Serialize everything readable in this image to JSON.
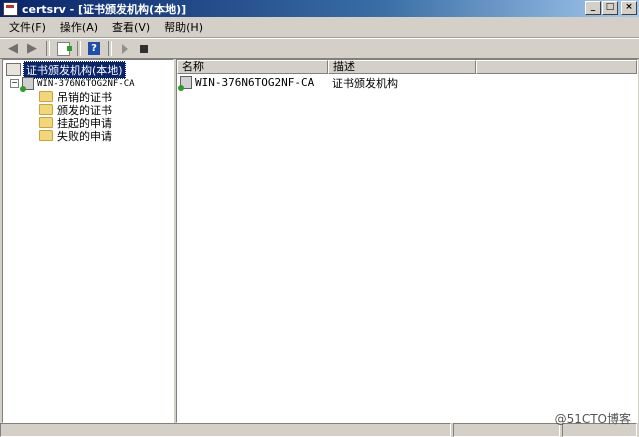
{
  "window": {
    "title": "certsrv - [证书颁发机构(本地)]",
    "buttons": [
      "_",
      "□",
      "×"
    ]
  },
  "menu": [
    {
      "label": "文件(F)"
    },
    {
      "label": "操作(A)"
    },
    {
      "label": "查看(V)"
    },
    {
      "label": "帮助(H)"
    }
  ],
  "toolbar": {
    "back_icon": "back-arrow-icon",
    "forward_icon": "forward-arrow-icon",
    "export_icon": "export-list-icon",
    "help_icon": "help-icon",
    "help_glyph": "?",
    "play_icon": "start-service-icon",
    "stop_icon": "stop-service-icon"
  },
  "tree": {
    "root_label": "证书颁发机构(本地)",
    "ca_label": "WIN-376N6TOG2NF-CA",
    "expander": "⊟",
    "folders": [
      "吊销的证书",
      "颁发的证书",
      "挂起的申请",
      "失败的申请"
    ]
  },
  "list": {
    "columns": [
      "名称",
      "描述"
    ],
    "rows": [
      {
        "name": "WIN-376N6TOG2NF-CA",
        "description": "证书颁发机构"
      }
    ]
  },
  "watermark": "@51CTO博客"
}
